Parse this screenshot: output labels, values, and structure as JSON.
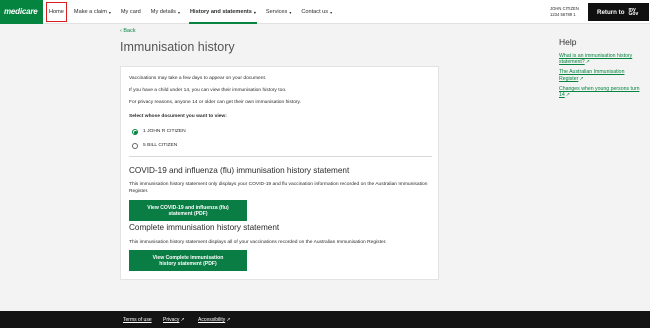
{
  "header": {
    "logo": "medicare",
    "nav": [
      {
        "label": "Home",
        "caret": ""
      },
      {
        "label": "Make a claim",
        "caret": "▾"
      },
      {
        "label": "My card",
        "caret": ""
      },
      {
        "label": "My details",
        "caret": "▾"
      },
      {
        "label": "History and statements",
        "caret": "▾"
      },
      {
        "label": "Services",
        "caret": "▾"
      },
      {
        "label": "Contact us",
        "caret": "▾"
      }
    ],
    "user_name": "JOHN CITIZEN",
    "user_number": "1234 56789 1",
    "return_label": "Return to",
    "mygov_line1": "my",
    "mygov_line2": "Gov"
  },
  "back_link": "‹ Back",
  "page_title": "Immunisation history",
  "card": {
    "intro": [
      "Vaccinations may take a few days to appear on your document.",
      "If you have a child under 14, you can view their immunisation history too.",
      "For privacy reasons, anyone 14 or older can get their own immunisation history."
    ],
    "select_label": "Select whose document you want to view:",
    "options": [
      {
        "label": "1 JOHN R CITIZEN",
        "selected": true
      },
      {
        "label": "5 BILL CITIZEN",
        "selected": false
      }
    ],
    "covid_heading": "COVID-19 and influenza (flu) immunisation history statement",
    "covid_desc": "This immunisation history statement only displays your COVID-19 and flu vaccination information recorded on the Australian Immunisation Register.",
    "covid_button": "View COVID-19 and influenza (flu) statement (PDF)",
    "complete_heading": "Complete immunisation history statement",
    "complete_desc": "This immunisation history statement displays all of your vaccinations recorded on the Australian Immunisation Register.",
    "complete_button": "View Complete immunisation history statement (PDF)"
  },
  "help": {
    "title": "Help",
    "links": [
      "What is an immunisation history statement?",
      "The Australian Immunisation Register",
      "Changes when young persons turn 14"
    ]
  },
  "footer": {
    "links": [
      "Terms of use",
      "Privacy",
      "Accessibility"
    ]
  },
  "colors": {
    "brand_green": "#04843f",
    "button_green": "#0a7d45",
    "footer": "#141414",
    "highlight": "#d81f1f"
  }
}
